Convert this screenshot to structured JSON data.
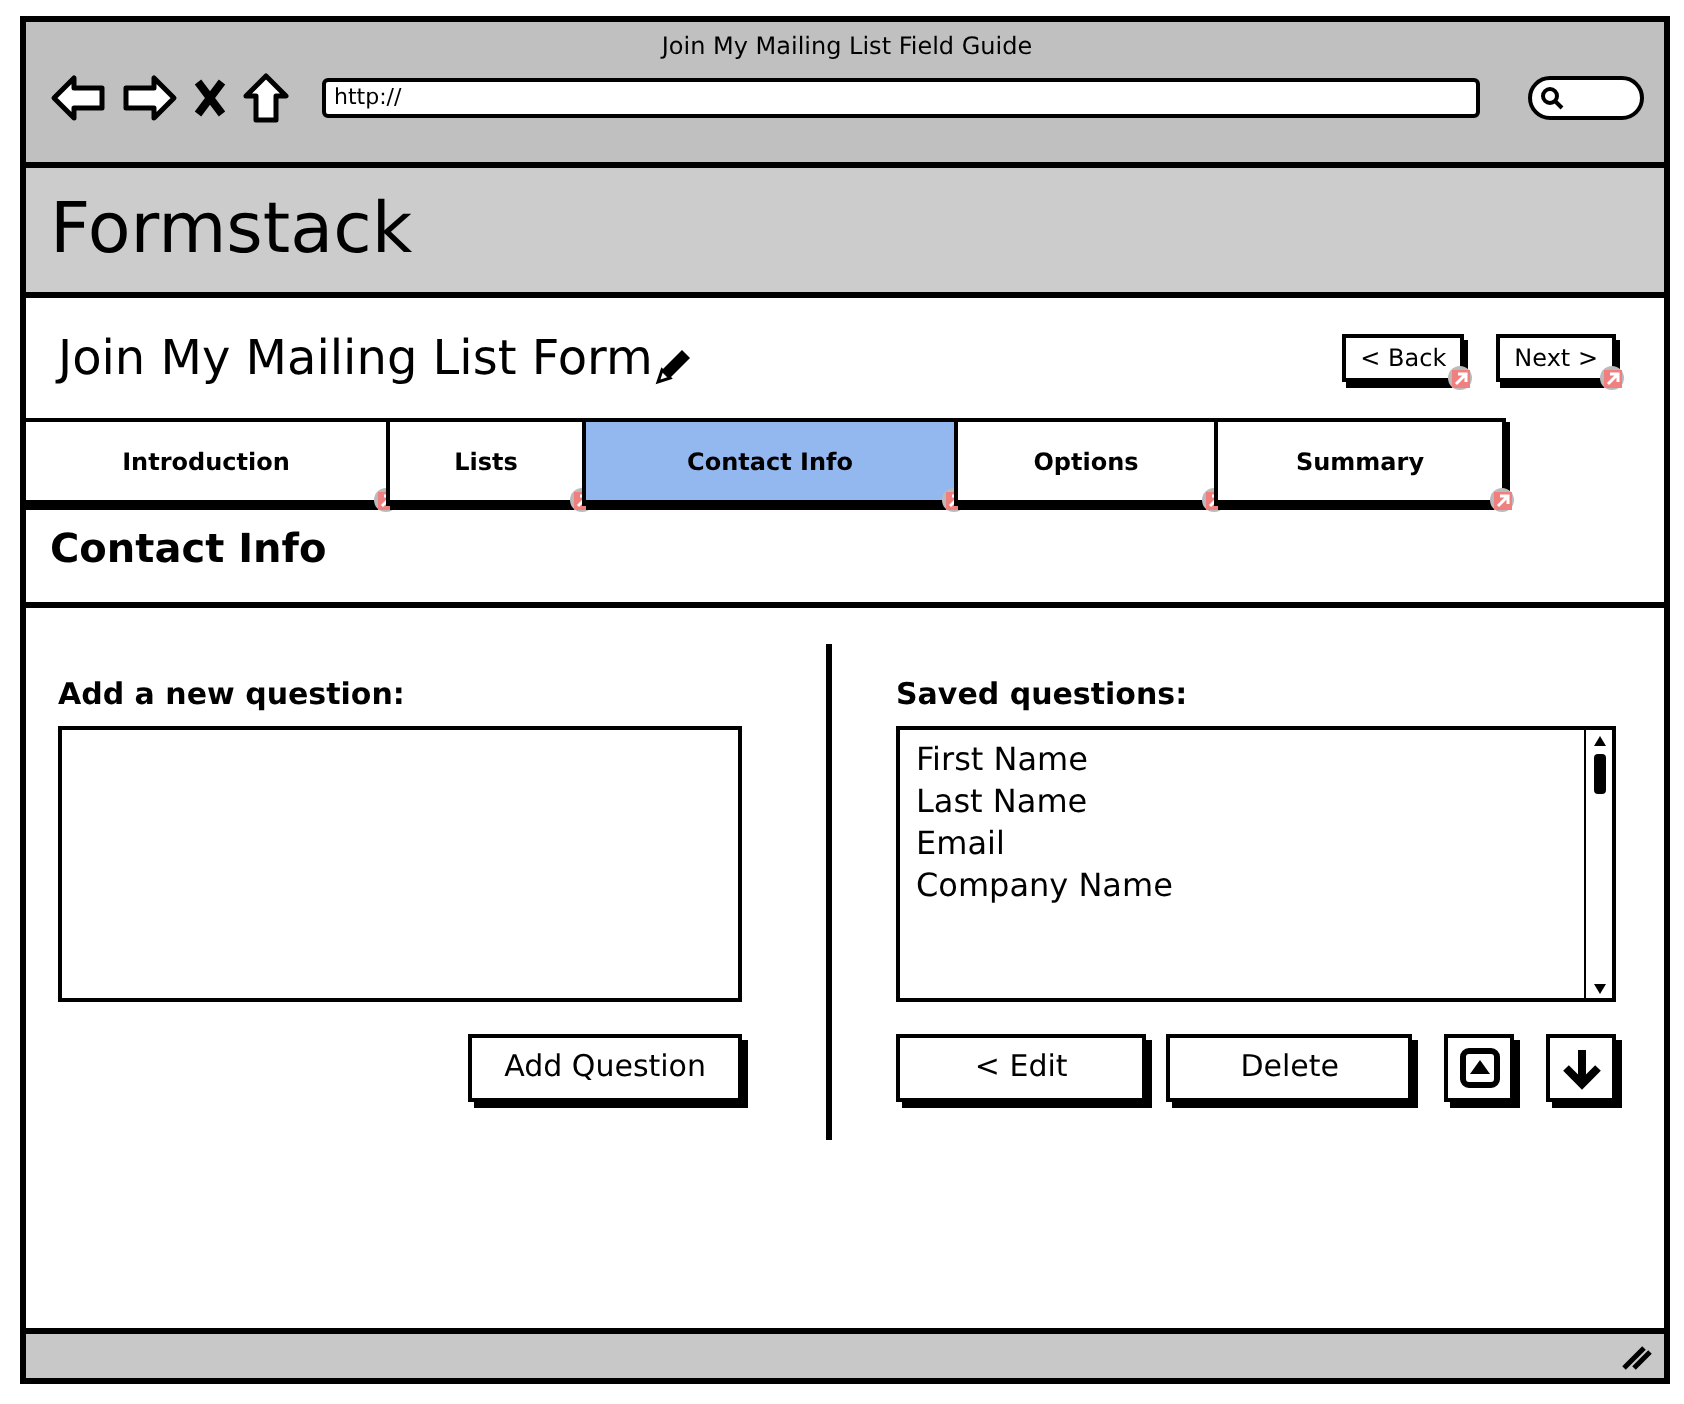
{
  "window": {
    "title": "Join My Mailing List Field Guide"
  },
  "address_bar": {
    "value": "http://"
  },
  "app_header": {
    "title": "Formstack"
  },
  "form": {
    "title": "Join My Mailing List Form"
  },
  "nav_buttons": [
    "< Back",
    "Next >"
  ],
  "tabs": [
    {
      "label": "Introduction",
      "selected": false
    },
    {
      "label": "Lists",
      "selected": false
    },
    {
      "label": "Contact Info",
      "selected": true
    },
    {
      "label": "Options",
      "selected": false
    },
    {
      "label": "Summary",
      "selected": false
    }
  ],
  "section": {
    "title": "Contact Info"
  },
  "new_question": {
    "label": "Add a new question:",
    "button": "Add Question"
  },
  "saved_questions": {
    "label": "Saved questions:",
    "items": [
      "First Name",
      "Last Name",
      "Email",
      "Company Name"
    ],
    "buttons": [
      "< Edit",
      "Delete"
    ]
  }
}
